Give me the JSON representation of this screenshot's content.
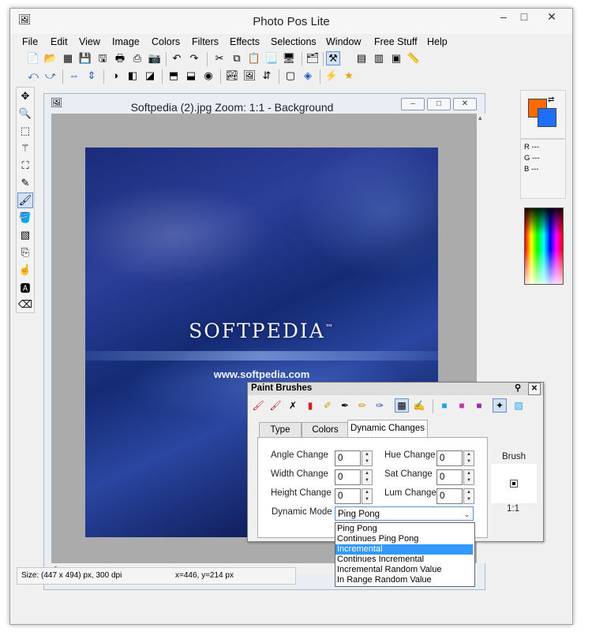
{
  "app": {
    "title": "Photo Pos Lite",
    "window_buttons": {
      "minimize": "–",
      "maximize": "□",
      "close": "✕"
    }
  },
  "menubar": [
    "File",
    "Edit",
    "View",
    "Image",
    "Colors",
    "Filters",
    "Effects",
    "Selections",
    "Window",
    "Free Stuff",
    "Help"
  ],
  "document": {
    "title": "Softpedia (2).jpg  Zoom: 1:1 - Background",
    "logo_text": "SOFTPEDIA",
    "trademark": "™",
    "url_text": "www.softpedia.com",
    "size_text": "Size: (447 x 494) px, 300 dpi",
    "coords_text": "x=446, y=214 px"
  },
  "rgb": {
    "r": "R ---",
    "g": "G ---",
    "b": "B ---"
  },
  "brushes": {
    "title": "Paint Brushes",
    "tabs": [
      "Type",
      "Colors",
      "Dynamic Changes"
    ],
    "active_tab": "Dynamic Changes",
    "fields": {
      "angle": {
        "label": "Angle Change",
        "value": "0"
      },
      "width": {
        "label": "Width Change",
        "value": "0"
      },
      "height": {
        "label": "Height Change",
        "value": "0"
      },
      "hue": {
        "label": "Hue Change",
        "value": "0"
      },
      "sat": {
        "label": "Sat Change",
        "value": "0"
      },
      "lum": {
        "label": "Lum Change",
        "value": "0"
      }
    },
    "dynamic_mode_label": "Dynamic Mode",
    "dynamic_mode_value": "Ping Pong",
    "brush_label": "Brush",
    "brush_scale": "1:1",
    "options": [
      "Ping Pong",
      "Continues Ping Pong",
      "Incremental",
      "Continues Incremental",
      "Incremental Random Value",
      "In Range Random Value"
    ],
    "highlighted_option": "Incremental"
  },
  "colors": {
    "foreground": "#ff6a00",
    "background": "#1e6ff5",
    "selection_highlight": "#3399ff"
  }
}
